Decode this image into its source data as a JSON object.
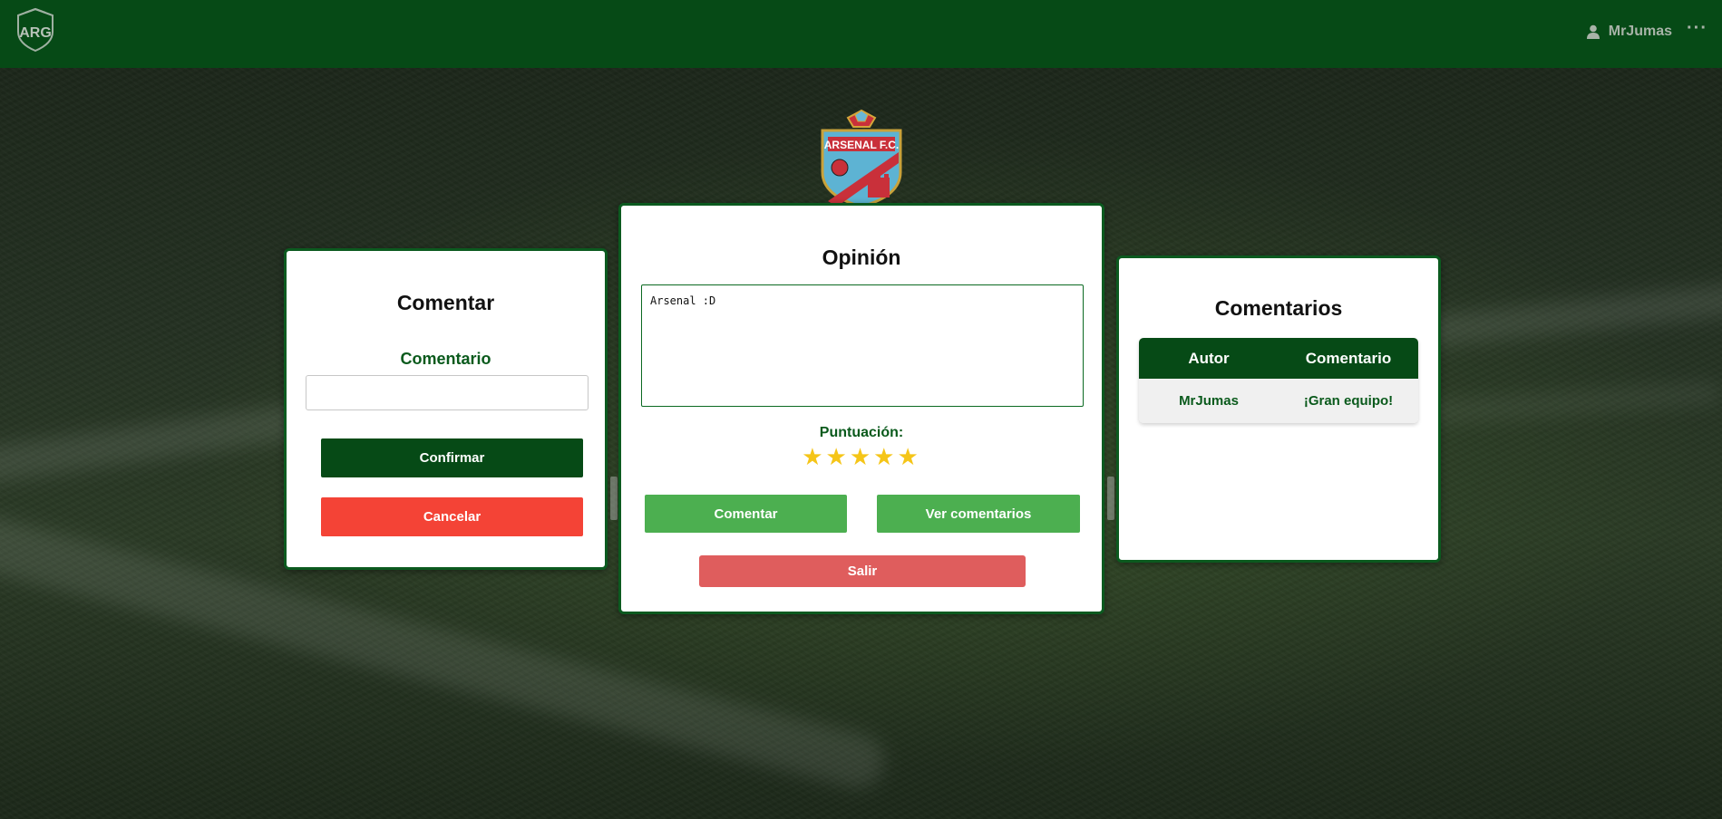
{
  "navbar": {
    "logo_text": "ARG",
    "user_name": "MrJumas",
    "more_label": "···"
  },
  "crest": {
    "name": "ARSENAL F.C."
  },
  "comment_form": {
    "title": "Comentar",
    "field_label": "Comentario",
    "field_value": "",
    "confirm_label": "Confirmar",
    "cancel_label": "Cancelar"
  },
  "opinion": {
    "title": "Opinión",
    "text": "Arsenal :D",
    "score_label": "Puntuación:",
    "rating": 5,
    "rating_max": 5,
    "comment_label": "Comentar",
    "view_comments_label": "Ver comentarios",
    "exit_label": "Salir"
  },
  "comments": {
    "title": "Comentarios",
    "columns": [
      "Autor",
      "Comentario"
    ],
    "rows": [
      {
        "author": "MrJumas",
        "comment": "¡Gran equipo!"
      }
    ]
  },
  "colors": {
    "navbar": "#064a16",
    "primary_dark": "#064a16",
    "accent_green": "#4caf50",
    "danger": "#f44336",
    "danger_soft": "#df5d5d",
    "star": "#f5c518"
  }
}
